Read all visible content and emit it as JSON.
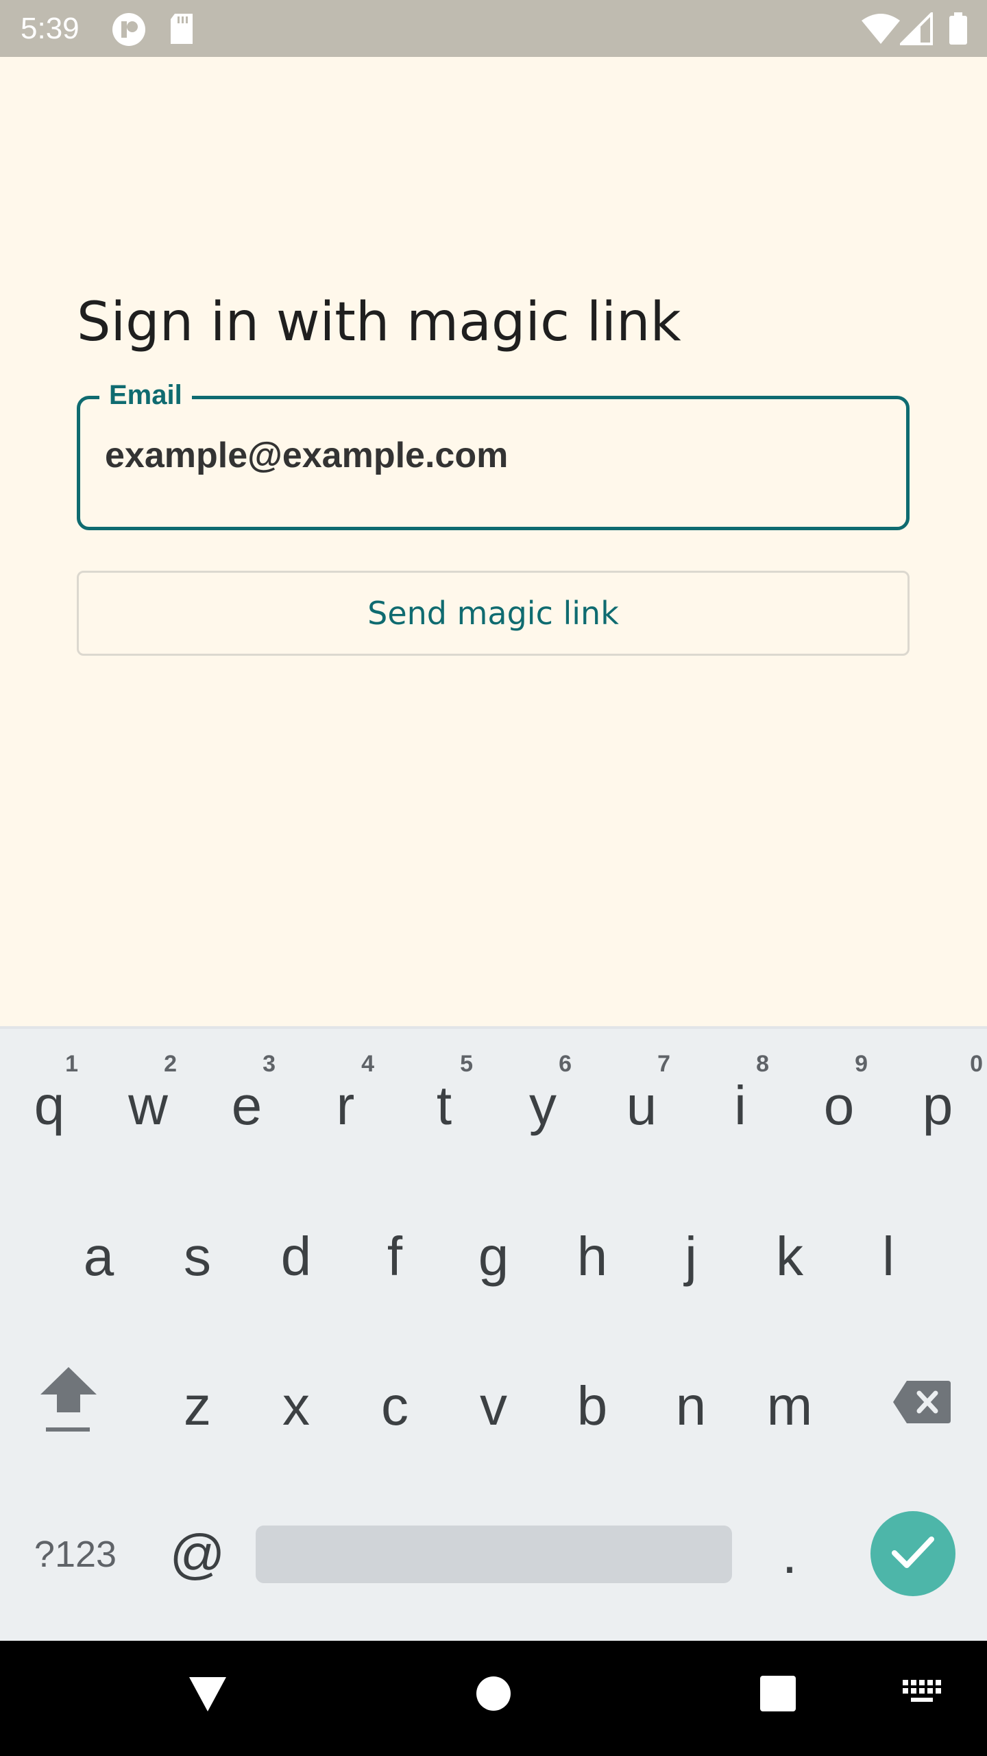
{
  "status_bar": {
    "time": "5:39",
    "icons": [
      "notification-app-icon",
      "sd-card-icon",
      "wifi-icon",
      "cell-signal-icon",
      "battery-icon"
    ]
  },
  "screen": {
    "title": "Sign in with magic link",
    "email_field": {
      "label": "Email",
      "value": "example@example.com"
    },
    "send_button_label": "Send magic link"
  },
  "colors": {
    "background": "#fff8eb",
    "accent": "#0f6b70",
    "keyboard_bg": "#eceff1",
    "enter_key": "#4db6a9"
  },
  "keyboard": {
    "row1": [
      {
        "key": "q",
        "hint": "1"
      },
      {
        "key": "w",
        "hint": "2"
      },
      {
        "key": "e",
        "hint": "3"
      },
      {
        "key": "r",
        "hint": "4"
      },
      {
        "key": "t",
        "hint": "5"
      },
      {
        "key": "y",
        "hint": "6"
      },
      {
        "key": "u",
        "hint": "7"
      },
      {
        "key": "i",
        "hint": "8"
      },
      {
        "key": "o",
        "hint": "9"
      },
      {
        "key": "p",
        "hint": "0"
      }
    ],
    "row2": [
      "a",
      "s",
      "d",
      "f",
      "g",
      "h",
      "j",
      "k",
      "l"
    ],
    "row3": [
      "z",
      "x",
      "c",
      "v",
      "b",
      "n",
      "m"
    ],
    "symbols_label": "?123",
    "at_label": "@",
    "period_label": ".",
    "icons": [
      "shift-icon",
      "backspace-icon",
      "checkmark-icon"
    ]
  },
  "nav_bar": {
    "icons": [
      "back-icon",
      "home-icon",
      "recents-icon",
      "keyboard-switch-icon"
    ]
  }
}
